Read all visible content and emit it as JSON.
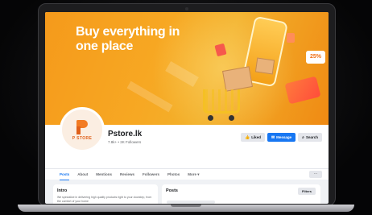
{
  "cover": {
    "headline": "Buy everything in one place",
    "sale_badge": "25%"
  },
  "logo": {
    "text": "P STORE"
  },
  "page": {
    "name": "Pstore.lk",
    "stats": "7.8k+ • 2K Followers"
  },
  "actions": {
    "liked_label": "Liked",
    "message_label": "Message",
    "search_label": "Search"
  },
  "tabs": [
    {
      "label": "Posts"
    },
    {
      "label": "About"
    },
    {
      "label": "Mentions"
    },
    {
      "label": "Reviews"
    },
    {
      "label": "Followers"
    },
    {
      "label": "Photos"
    },
    {
      "label": "More ▾"
    }
  ],
  "more_button": "···",
  "intro": {
    "heading": "Intro",
    "text": "We specialize in delivering high quality products right to your doorstep, from the comfort of your home"
  },
  "posts": {
    "heading": "Posts",
    "filters_label": "Filters"
  },
  "colors": {
    "accent": "#1877f2",
    "cover": "#f59a1b",
    "brand": "#f27b23"
  }
}
